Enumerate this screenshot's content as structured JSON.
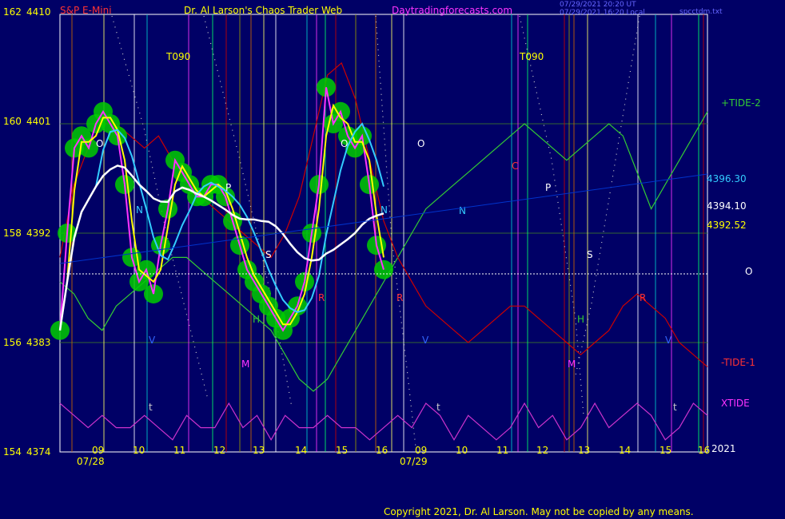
{
  "header": {
    "instrument": "S&P E-Mini",
    "title": "Dr. Al Larson's Chaos Trader Web",
    "site": "Daytradingforecasts.com",
    "timestamp1": "07/29/2021 20:20 UT",
    "timestamp2": "07/29/2021 16:20 Local",
    "file": "spcctdm.txt"
  },
  "copyright": "Copyright 2021, Dr. Al Larson. May not be copied by any means.",
  "colors": {
    "background": "#000066",
    "price": "#00ff00",
    "ma_fast": "#ffff00",
    "ma_mid": "#33ccff",
    "ma_slow": "#ffffff",
    "tide_plus": "#33cc33",
    "tide_minus": "#cc0000",
    "xtide": "#cc33cc"
  },
  "chart_data": {
    "type": "line",
    "title": "S&P E-Mini",
    "y_left_labels": [
      "162",
      "160",
      "158",
      "156",
      "154"
    ],
    "y_price_labels": [
      "4410",
      "4401",
      "4392",
      "4383",
      "4374"
    ],
    "ylim": [
      4374,
      4410
    ],
    "x_hour_labels": [
      "09",
      "10",
      "11",
      "12",
      "13",
      "14",
      "15",
      "16",
      "09",
      "10",
      "11",
      "12",
      "13",
      "14",
      "15",
      "16"
    ],
    "x_date_labels": [
      "07/28",
      "07/29"
    ],
    "right_labels": {
      "tide_plus": "+TIDE-2",
      "tide_minus": "-TIDE-1",
      "xtide": "XTIDE",
      "p1": "4396.30",
      "p2": "4394.10",
      "p3": "4392.52",
      "o": "O",
      "year": "2021"
    },
    "markers": {
      "t090": "T090",
      "letters": [
        "O",
        "O",
        "O",
        "N",
        "N",
        "N",
        "P",
        "P",
        "S",
        "S",
        "H",
        "H",
        "M",
        "M",
        "R",
        "R",
        "R",
        "C",
        "t",
        "t",
        "t",
        "V",
        "V",
        "V"
      ]
    },
    "series": [
      {
        "values": [
          4384,
          4392,
          4399,
          4400,
          4399,
          4401,
          4402,
          4401,
          4400,
          4396,
          4390,
          4388,
          4389,
          4387,
          4391,
          4394,
          4398,
          4397,
          4396,
          4395,
          4395,
          4396,
          4396,
          4395,
          4393,
          4391,
          4389,
          4388,
          4387,
          4386,
          4385,
          4384,
          4385,
          4386,
          4388,
          4392,
          4396,
          4404,
          4401,
          4402,
          4400,
          4399,
          4400,
          4396,
          4391,
          4389
        ]
      },
      {
        "name": "+TIDE-2",
        "values": [
          4388,
          4387,
          4385,
          4384,
          4386,
          4387,
          4388,
          4389,
          4390,
          4390,
          4389,
          4388,
          4387,
          4386,
          4385,
          4384,
          4382,
          4380,
          4379,
          4380,
          4382,
          4384,
          4386,
          4388,
          4390,
          4392,
          4394,
          4395,
          4396,
          4397,
          4398,
          4399,
          4400,
          4401,
          4400,
          4399,
          4398,
          4399,
          4400,
          4401,
          4400,
          4397,
          4394,
          4396,
          4398,
          4400,
          4402
        ]
      },
      {
        "name": "-TIDE-1",
        "values": [
          4390,
          4396,
          4399,
          4401,
          4401,
          4400,
          4399,
          4400,
          4398,
          4397,
          4395,
          4394,
          4393,
          4392,
          4391,
          4390,
          4392,
          4395,
          4400,
          4405,
          4406,
          4403,
          4398,
          4393,
          4390,
          4388,
          4386,
          4385,
          4384,
          4383,
          4384,
          4385,
          4386,
          4386,
          4385,
          4384,
          4383,
          4382,
          4383,
          4384,
          4386,
          4387,
          4386,
          4385,
          4383,
          4382,
          4381
        ]
      },
      {
        "name": "XTIDE",
        "values": [
          4378,
          4377,
          4376,
          4377,
          4376,
          4376,
          4377,
          4376,
          4375,
          4377,
          4376,
          4376,
          4378,
          4376,
          4377,
          4375,
          4377,
          4376,
          4376,
          4377,
          4376,
          4376,
          4375,
          4376,
          4377,
          4376,
          4378,
          4377,
          4375,
          4377,
          4376,
          4375,
          4376,
          4378,
          4376,
          4377,
          4375,
          4376,
          4378,
          4376,
          4377,
          4378,
          4377,
          4375,
          4376,
          4378,
          4377
        ]
      }
    ]
  }
}
